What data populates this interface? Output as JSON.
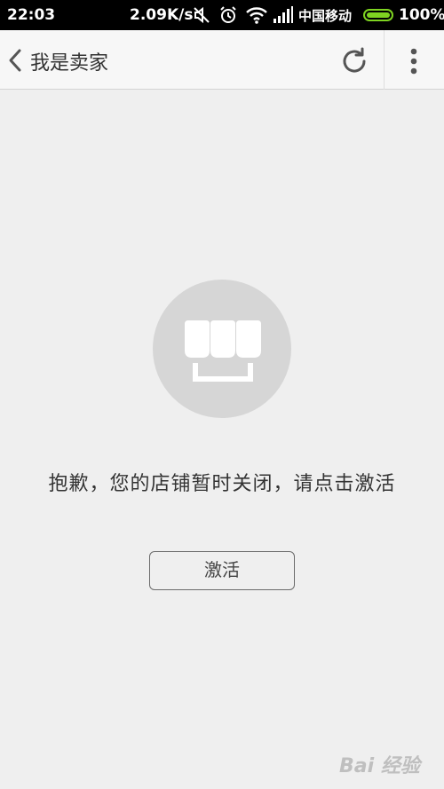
{
  "status_bar": {
    "time": "22:03",
    "net_speed": "2.09K/s",
    "carrier": "中国移动",
    "battery_pct": "100%",
    "battery_level": 1.0,
    "icons": [
      "mute-icon",
      "alarm-icon",
      "wifi-icon",
      "signal-icon",
      "battery-icon"
    ]
  },
  "app_bar": {
    "title": "我是卖家",
    "icons": {
      "back": "chevron-left-icon",
      "refresh": "refresh-icon",
      "more": "more-vertical-icon"
    }
  },
  "content": {
    "icon": "shop-icon",
    "message": "抱歉，您的店铺暂时关闭，请点击激活",
    "activate_label": "激活"
  },
  "watermark": {
    "text": "Bai 经验"
  },
  "colors": {
    "background": "#efefef",
    "appbar": "#f7f7f7",
    "badge": "#d6d6d6",
    "battery": "#7ed321",
    "text": "#333333"
  }
}
